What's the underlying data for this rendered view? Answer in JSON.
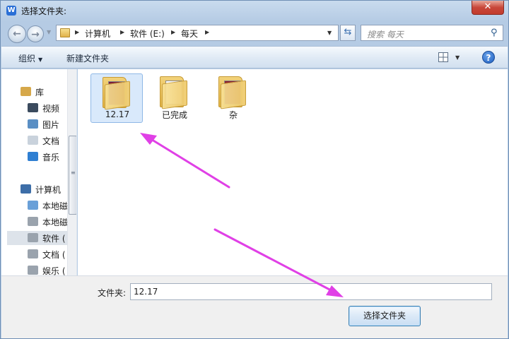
{
  "window": {
    "title": "选择文件夹:",
    "close_glyph": "✕"
  },
  "address": {
    "crumbs": [
      "计算机",
      "软件 (E:)",
      "每天"
    ],
    "search_placeholder": "搜索 每天"
  },
  "toolbar": {
    "organize_label": "组织",
    "new_folder_label": "新建文件夹"
  },
  "nav": {
    "items": [
      {
        "label": "库",
        "icon": "library-icon",
        "color": "#d6a84a"
      },
      {
        "label": "视频",
        "icon": "video-icon",
        "color": "#3b4b5e"
      },
      {
        "label": "图片",
        "icon": "picture-icon",
        "color": "#5a8fc4"
      },
      {
        "label": "文档",
        "icon": "document-icon",
        "color": "#c9d2dc"
      },
      {
        "label": "音乐",
        "icon": "music-icon",
        "color": "#2f7fd2"
      },
      {
        "label": "计算机",
        "icon": "computer-icon",
        "color": "#3d6ea8"
      },
      {
        "label": "本地磁",
        "icon": "windows-drive-icon",
        "color": "#6aa0d8"
      },
      {
        "label": "本地磁",
        "icon": "drive-icon",
        "color": "#9aa3ad"
      },
      {
        "label": "软件 (",
        "icon": "drive-icon",
        "color": "#9aa3ad"
      },
      {
        "label": "文档 (",
        "icon": "drive-icon",
        "color": "#9aa3ad"
      },
      {
        "label": "娱乐 (",
        "icon": "drive-icon",
        "color": "#9aa3ad"
      }
    ]
  },
  "folders": [
    {
      "label": "12.17",
      "paper_color": "#7a1c3a"
    },
    {
      "label": "已完成",
      "paper_color": "#ffffff"
    },
    {
      "label": "杂",
      "paper_color": "#8a1e2c"
    }
  ],
  "bottom": {
    "folder_field_label": "文件夹:",
    "folder_field_value": "12.17",
    "select_button_label": "选择文件夹"
  },
  "colors": {
    "annotation_arrow": "#e040e6"
  }
}
